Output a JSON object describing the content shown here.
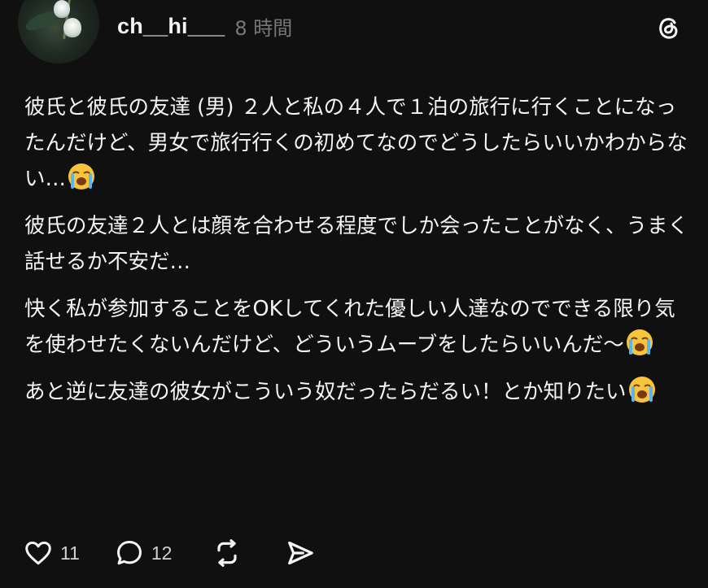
{
  "post": {
    "author": {
      "username": "ch__hi___",
      "time": "8 時間"
    },
    "paragraphs": [
      "彼氏と彼氏の友達 (男) ２人と私の４人で１泊の旅行に行くことになったんだけど、男女で旅行行くの初めてなのでどうしたらいいかわからない…",
      "彼氏の友達２人とは顔を合わせる程度でしか会ったことがなく、うまく話せるか不安だ…",
      "快く私が参加することをOKしてくれた優しい人達なのでできる限り気を使わせたくないんだけど、どういうムーブをしたらいいんだ〜",
      "あと逆に友達の彼女がこういう奴だったらだるい！とか知りたい"
    ],
    "emoji": "loudly-crying-face",
    "actions": {
      "likes": "11",
      "replies": "12"
    }
  },
  "icons": [
    "threads-icon",
    "heart-icon",
    "comment-icon",
    "repost-icon",
    "share-icon"
  ],
  "colors": {
    "background": "#101010",
    "text": "#f3f5f7",
    "muted": "#77777c"
  }
}
